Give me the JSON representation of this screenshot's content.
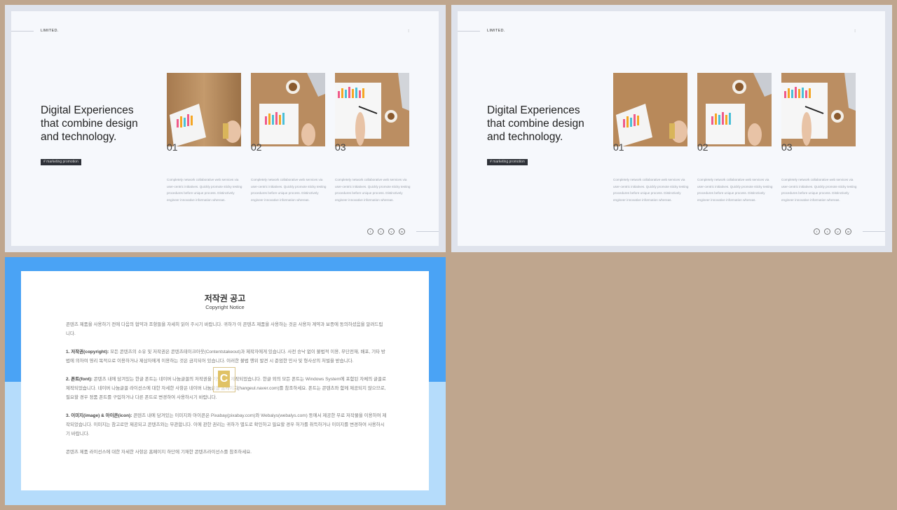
{
  "slides": [
    {
      "brand": "LIMITED.",
      "title": "Digital Experiences\nthat combine design\nand technology.",
      "tag": "# marketing  promotion",
      "cards": [
        {
          "num": "01",
          "desc": "Completely network collaborative web services via user-centric initiatives. Quickly promote sticky testing procedures before unique process. Distinctively engineer innovative information whereas."
        },
        {
          "num": "02",
          "desc": "Completely network collaborative web services via user-centric initiatives. Quickly promote sticky testing procedures before unique process. Distinctively engineer innovative information whereas."
        },
        {
          "num": "03",
          "desc": "Completely network collaborative web services via user-centric initiatives. Quickly promote sticky testing procedures before unique process. Distinctively engineer innovative information whereas."
        }
      ],
      "social": [
        "f",
        "t",
        "v",
        "in"
      ]
    },
    {
      "brand": "LIMITED.",
      "title": "Digital Experiences\nthat combine design\nand technology.",
      "tag": "# marketing  promotion",
      "cards": [
        {
          "num": "01",
          "desc": "Completely network collaborative web services via user-centric initiatives. Quickly promote sticky testing procedures before unique process. Distinctively engineer innovative information whereas."
        },
        {
          "num": "02",
          "desc": "Completely network collaborative web services via user-centric initiatives. Quickly promote sticky testing procedures before unique process. Distinctively engineer innovative information whereas."
        },
        {
          "num": "03",
          "desc": "Completely network collaborative web services via user-centric initiatives. Quickly promote sticky testing procedures before unique process. Distinctively engineer innovative information whereas."
        }
      ],
      "social": [
        "f",
        "t",
        "v",
        "in"
      ]
    }
  ],
  "notice": {
    "title": "저작권 공고",
    "subtitle": "Copyright Notice",
    "intro": "콘텐츠 제품을 사용하기 전에 다음의 협약과 조항들을 자세히 읽어 주시기 바랍니다. 귀하가 이 콘텐츠 제품을 사용하는 것은 사용자 계약과 보증에 동의하셨음을 알려드립니다.",
    "p1_head": "1. 저작권(copyright):",
    "p1": " 모든 콘텐츠의 소유 및 저작권은 콘텐츠테이크아웃(Contentstakeout)과 제작자에게 있습니다. 사전 승낙 없이 불법적 이용, 무단전재, 배포, 기타 방법에 의하여 영리 목적으로 이용하거나 제삼자에게 이용하는 것은 금지되어 있습니다. 이러한 불법 행위 발견 시 준엄한 민사 및 형사상의 처벌을 받습니다.",
    "p2_head": "2. 폰트(font):",
    "p2": " 콘텐츠 내에 담겨있는 한글 폰트는 네이버 나눔글꼴의 저작권을 기반하여 제작되었습니다. 한글 외의 모든 폰트는 Windows System에 포함된 자체의 글꼴로 제작되었습니다. 네이버 나눔글꼴 라이선스에 대한 자세한 사항은 네이버 나눔글꼴 홈페이지(hangeul.naver.com)를 참조하세요. 폰트는 콘텐츠와 함께 제공되지 않으므로, 필요할 경우 정품 폰트를 구입하거나 다른 폰트로 변경하여 사용하시기 바랍니다.",
    "p3_head": "3. 이미지(image) & 아이콘(icon):",
    "p3": " 콘텐츠 내에 담겨있는 이미지와 아이콘은 Pixabay(pixabay.com)와 Webalys(webalys.com) 등에서 제공한 무료 저작물을 이용하여 제작되었습니다. 이미지는 참고로만 제공되고 콘텐츠와는 무관합니다. 이에 관한 권리는 귀하가 별도로 확인하고 필요할 경우 허가를 취득하거나 이미지를 변경하여 사용하시기 바랍니다.",
    "outro": "콘텐츠 제품 라이선스에 대한 자세한 사항은 홈페이지 하단에 기재한 콘텐츠라이선스를 참조하세요.",
    "badge": "C"
  }
}
